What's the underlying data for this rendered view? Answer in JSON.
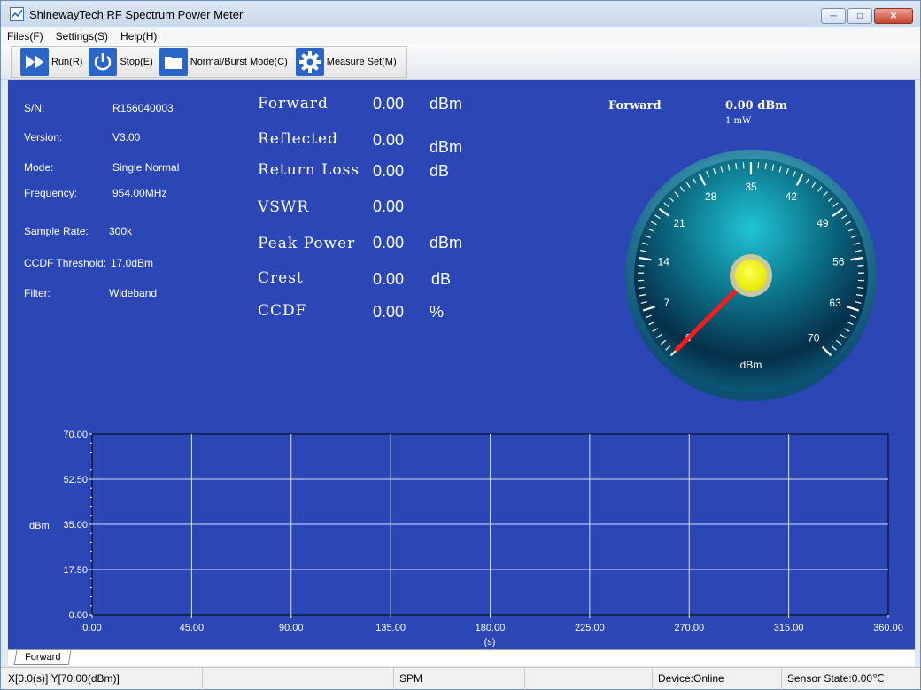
{
  "window": {
    "title": "ShinewayTech RF Spectrum Power Meter",
    "minimize_icon": "minimize-icon",
    "maximize_icon": "maximize-icon",
    "close_icon": "close-icon"
  },
  "menu": {
    "items": [
      "Files(F)",
      "Settings(S)",
      "Help(H)"
    ]
  },
  "toolbar": {
    "run_label": "Run(R)",
    "stop_label": "Stop(E)",
    "mode_label": "Normal/Burst Mode(C)",
    "measure_label": "Measure Set(M)"
  },
  "info": {
    "sn_label": "S/N:",
    "sn_value": "R156040003",
    "version_label": "Version:",
    "version_value": "V3.00",
    "mode_label": "Mode:",
    "mode_value": "Single Normal",
    "frequency_label": "Frequency:",
    "frequency_value": "954.00MHz",
    "sample_rate_label": "Sample Rate:",
    "sample_rate_value": "300k",
    "ccdf_threshold_label": "CCDF Threshold:",
    "ccdf_threshold_value": "17.0dBm",
    "filter_label": "Filter:",
    "filter_value": "Wideband"
  },
  "measurements": [
    {
      "label": "Forward",
      "value": "0.00",
      "unit": "dBm"
    },
    {
      "label": "Reflected",
      "value": "0.00",
      "unit": "dBm"
    },
    {
      "label": "Return Loss",
      "value": "0.00",
      "unit": "dB"
    },
    {
      "label": "VSWR",
      "value": "0.00",
      "unit": ""
    },
    {
      "label": "Peak Power",
      "value": "0.00",
      "unit": "dBm"
    },
    {
      "label": "Crest",
      "value": "0.00",
      "unit": "dB"
    },
    {
      "label": "CCDF",
      "value": "0.00",
      "unit": "%"
    }
  ],
  "gauge": {
    "title": "Forward",
    "value_text": "0.00 dBm",
    "sub_text": "1 mW",
    "unit": "dBm",
    "min": 0,
    "max": 70,
    "value": 0,
    "tick_labels": [
      "0",
      "7",
      "14",
      "21",
      "28",
      "35",
      "42",
      "49",
      "56",
      "63",
      "70"
    ]
  },
  "chart_data": {
    "type": "line",
    "title": "",
    "xlabel": "(s)",
    "ylabel": "dBm",
    "xlim": [
      0,
      360
    ],
    "ylim": [
      0,
      70
    ],
    "x_ticks": [
      "0.00",
      "45.00",
      "90.00",
      "135.00",
      "180.00",
      "225.00",
      "270.00",
      "315.00",
      "360.00"
    ],
    "y_ticks": [
      "0.00",
      "17.50",
      "35.00",
      "52.50",
      "70.00"
    ],
    "grid": true,
    "series": [
      {
        "values": []
      }
    ]
  },
  "tabs": [
    "Forward"
  ],
  "status": {
    "cursor": "X[0.0(s)] Y[70.00(dBm)]",
    "mode": "SPM",
    "device": "Device:Online",
    "sensor": "Sensor State:0.00℃"
  },
  "colors": {
    "panel_bg": "#2b47b6",
    "needle": "#ff1a1a",
    "gauge_hub": "#f5f52a"
  }
}
